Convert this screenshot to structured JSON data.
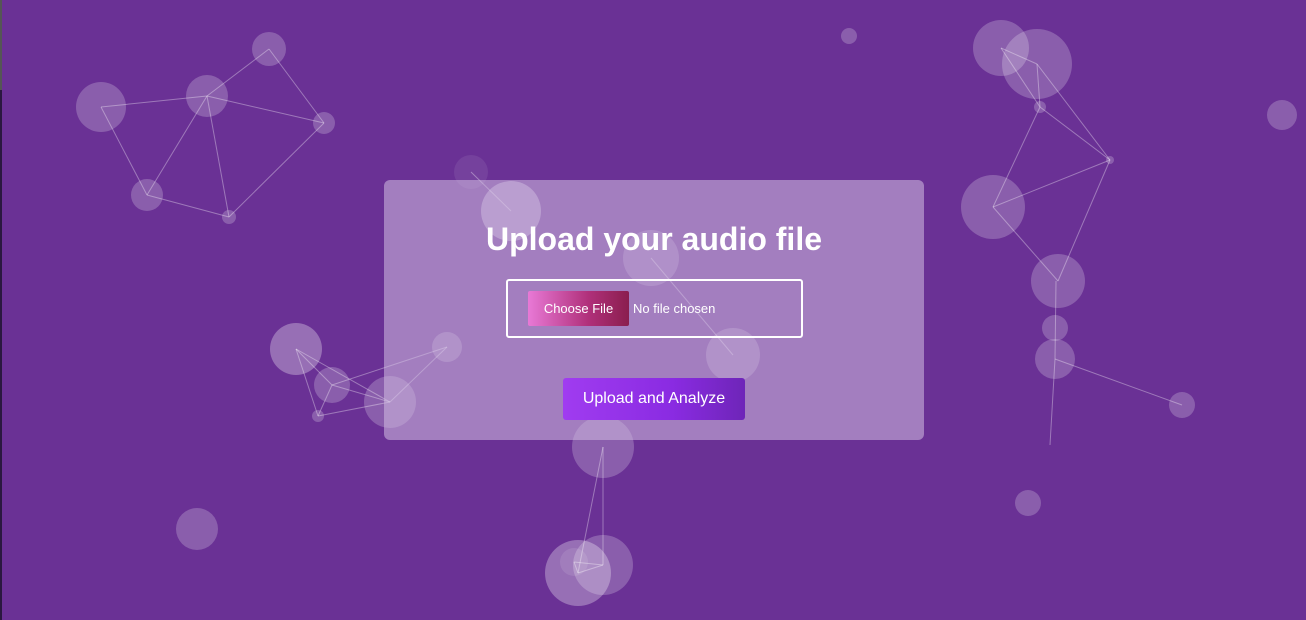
{
  "page": {
    "background_color": "#6a3195"
  },
  "upload_card": {
    "title": "Upload your audio file",
    "file_input": {
      "button_label": "Choose File",
      "status_text": "No file chosen"
    },
    "submit_label": "Upload and Analyze"
  }
}
